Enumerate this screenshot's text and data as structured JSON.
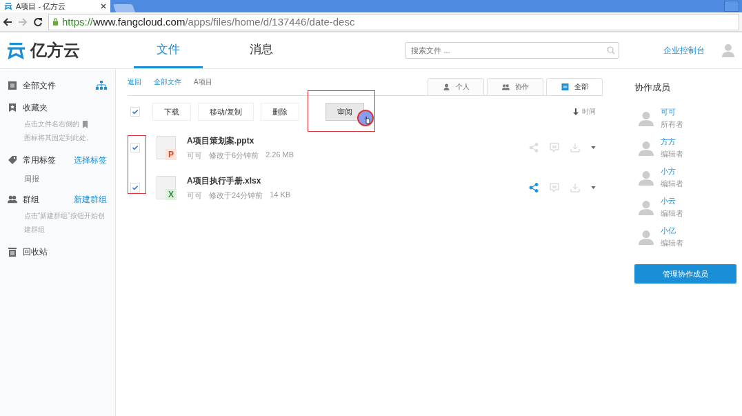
{
  "browser": {
    "tab_title": "A项目 - 亿方云",
    "url_scheme": "https://",
    "url_host": "www.fangcloud.com",
    "url_path": "/apps/files/home/d/137446/date-desc"
  },
  "header": {
    "logo": "亿方云",
    "nav": [
      {
        "label": "文件",
        "selected": true
      },
      {
        "label": "消息",
        "selected": false
      }
    ],
    "search": {
      "placeholder": "搜索文件 ..."
    },
    "admin_link": "企业控制台"
  },
  "sidebar": [
    {
      "kind": "files",
      "label": "全部文件"
    },
    {
      "kind": "favorites",
      "label": "收藏夹",
      "hint_before": "点击文件名右侧的",
      "hint_after": "图标将其固定到此处。"
    },
    {
      "kind": "tags",
      "label": "常用标签",
      "action": "选择标签",
      "items": [
        "周报"
      ]
    },
    {
      "kind": "groups",
      "label": "群组",
      "action": "新建群组",
      "hint_before": "点击“新建群组”按钮开始创建群组"
    },
    {
      "kind": "trash",
      "label": "回收站"
    }
  ],
  "breadcrumb": [
    {
      "label": "返回",
      "link": true
    },
    {
      "label": "全部文件",
      "link": true
    },
    {
      "label": "A项目",
      "link": false
    }
  ],
  "view_tabs": [
    {
      "kind": "personal",
      "label": "个人",
      "selected": false
    },
    {
      "kind": "collab",
      "label": "协作",
      "selected": false
    },
    {
      "kind": "all",
      "label": "全部",
      "selected": true
    }
  ],
  "toolbar": {
    "select_all": true,
    "buttons": [
      {
        "label": "下载",
        "pressed": false
      },
      {
        "label": "移动/复制",
        "pressed": false
      },
      {
        "label": "删除",
        "pressed": false
      },
      {
        "label": "审阅",
        "pressed": true
      }
    ],
    "sort": "时间"
  },
  "files": [
    {
      "kind": "pptx",
      "badge": "P",
      "name": "A项目策划案.pptx",
      "owner": "可可",
      "modified": "修改于6分钟前",
      "size": "2.26 MB",
      "checked": true,
      "shared": false
    },
    {
      "kind": "xlsx",
      "badge": "X",
      "name": "A项目执行手册.xlsx",
      "owner": "可可",
      "modified": "修改于24分钟前",
      "size": "14 KB",
      "checked": true,
      "shared": true
    }
  ],
  "members_panel": {
    "title": "协作成员",
    "members": [
      {
        "name": "可可",
        "role": "所有者"
      },
      {
        "name": "方方",
        "role": "编辑者"
      },
      {
        "name": "小方",
        "role": "编辑者"
      },
      {
        "name": "小云",
        "role": "编辑者"
      },
      {
        "name": "小亿",
        "role": "编辑者"
      }
    ],
    "manage_button": "管理协作成员"
  }
}
